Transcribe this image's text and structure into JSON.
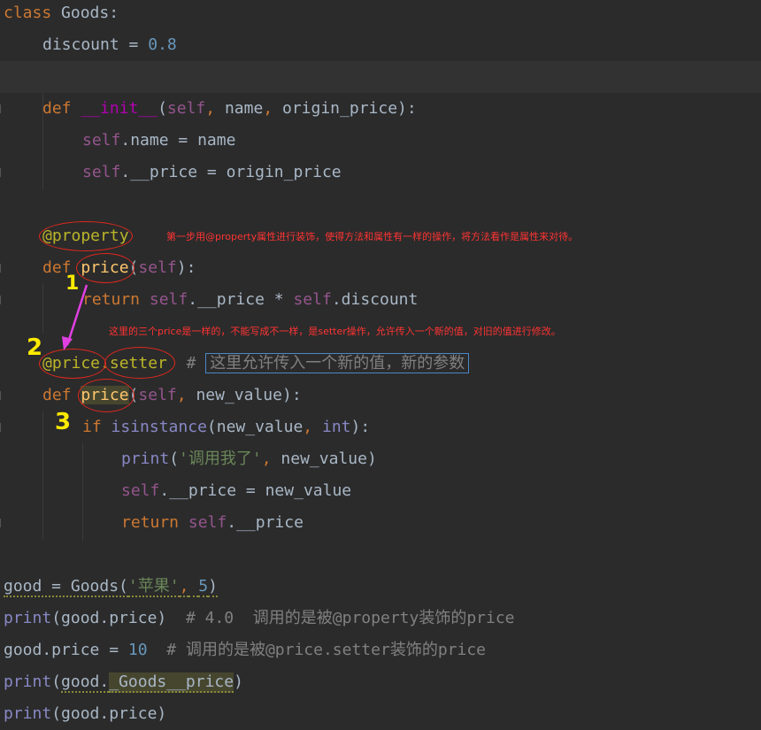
{
  "code": {
    "class_kw": "class",
    "class_name": "Goods",
    "discount_var": "discount",
    "eq": "=",
    "discount_val": "0.8",
    "def_kw": "def",
    "init_name": "__init__",
    "self": "self",
    "name_param": "name",
    "origin_param": "origin_price",
    "name_attr": ".name",
    "name_val": "name",
    "price_attr": ".__price",
    "origin_val": "origin_price",
    "decorator_property": "@property",
    "price_fn": "price",
    "return_kw": "return",
    "mult": "*",
    "discount_attr": ".discount",
    "setter_deco_at": "@price",
    "setter_deco_rest": ".setter",
    "hash": "#",
    "setter_comment": "这里允许传入一个新的值，新的参数",
    "new_value": "new_value",
    "if_kw": "if",
    "isinstance": "isinstance",
    "int": "int",
    "print": "print",
    "print_str": "'调用我了'",
    "good_assign": "good = Goods(",
    "apple_str": "'苹果'",
    "five": "5",
    "close_paren": ")",
    "print_good_price": "good.price)",
    "comment_40": "# 4.0  调用的是被@property装饰的price",
    "good_price_assign": "good.price = ",
    "ten": "10",
    "comment_setter": "# 调用的是被@price.setter装饰的price",
    "print_mangled_pre": "good.",
    "print_mangled": "_Goods__price",
    "print_last": "good.price)"
  },
  "annotations": {
    "note1": "第一步用@property属性进行装饰，使得方法和属性有一样的操作，将方法看作是属性来对待。",
    "note2": "这里的三个price是一样的，不能写成不一样，是setter操作，允许传入一个新的值，对旧的值进行修改。",
    "marker1": "1",
    "marker2": "2",
    "marker3": "3"
  },
  "colors": {
    "background": "#2b2b2b",
    "keyword": "#cc7832",
    "self": "#94558d",
    "annotation_red": "#e0281e",
    "marker_yellow": "#ffea00",
    "arrow_magenta": "#e040e0"
  }
}
